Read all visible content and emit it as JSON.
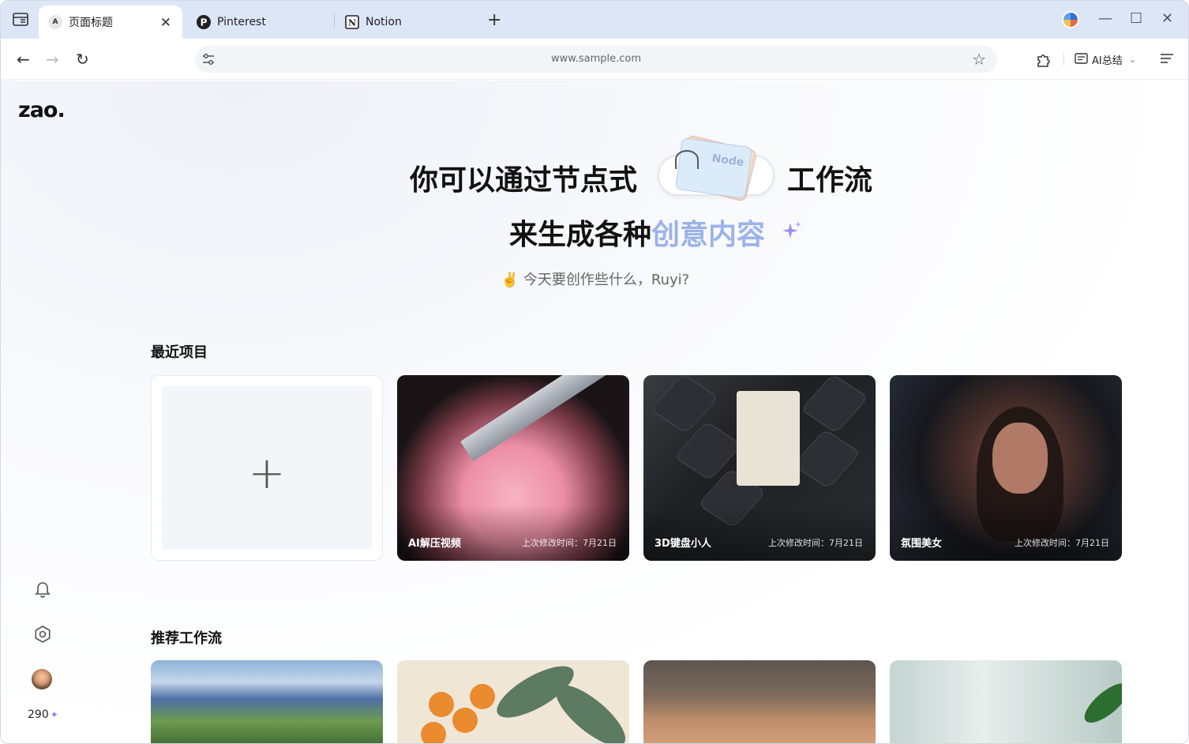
{
  "browser": {
    "tabs": [
      {
        "label": "页面标题",
        "favicon": "A",
        "active": true
      },
      {
        "label": "Pinterest",
        "favicon": "pinterest-icon",
        "active": false
      },
      {
        "label": "Notion",
        "favicon": "notion-icon",
        "active": false
      }
    ],
    "url": "www.sample.com",
    "ai_summary_label": "AI总结"
  },
  "app": {
    "logo": "zao.",
    "hero": {
      "line1_left": "你可以通过节点式",
      "node_badge": "Node",
      "line1_right": "工作流",
      "line2_plain": "来生成各种",
      "line2_accent": "创意内容",
      "greeting": "✌️ 今天要创作些什么，Ruyi?"
    },
    "recent": {
      "title": "最近项目",
      "new_label": "+",
      "items": [
        {
          "name": "AI解压视频",
          "meta": "上次修改时间：7月21日"
        },
        {
          "name": "3D键盘小人",
          "meta": "上次修改时间：7月21日"
        },
        {
          "name": "氛围美女",
          "meta": "上次修改时间：7月21日"
        }
      ]
    },
    "recommended": {
      "title": "推荐工作流"
    },
    "sidebar": {
      "credits": "290"
    }
  },
  "colors": {
    "accent": "#9bb3ea",
    "tabbar_bg": "#dde6f7"
  }
}
